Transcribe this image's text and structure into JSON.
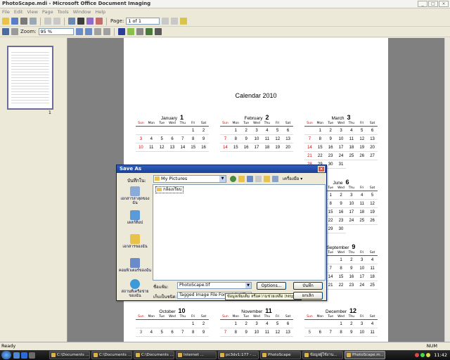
{
  "window": {
    "title": "PhotoScape.mdi - Microsoft Office Document Imaging",
    "controls": [
      "_",
      "□",
      "×"
    ]
  },
  "menu": [
    "File",
    "Edit",
    "View",
    "Page",
    "Tools",
    "Window",
    "Help"
  ],
  "toolbar1": {
    "page_label": "Page:",
    "page_value": "1 of 1"
  },
  "toolbar2": {
    "zoom_label": "Zoom:",
    "zoom_value": "95 %"
  },
  "thumbnail": {
    "page_number": "1"
  },
  "calendar": {
    "title": "Calendar  2010",
    "dow": [
      "Sun",
      "Mon",
      "Tue",
      "Wed",
      "Thu",
      "Fri",
      "Sat"
    ],
    "months": [
      {
        "name": "January",
        "num": "1",
        "days": [
          "",
          "",
          "",
          "",
          "",
          "1",
          "2",
          "3",
          "4",
          "5",
          "6",
          "7",
          "8",
          "9",
          "10",
          "11",
          "12",
          "13",
          "14",
          "15",
          "16"
        ]
      },
      {
        "name": "February",
        "num": "2",
        "days": [
          "",
          "1",
          "2",
          "3",
          "4",
          "5",
          "6",
          "7",
          "8",
          "9",
          "10",
          "11",
          "12",
          "13",
          "14",
          "15",
          "16",
          "17",
          "18",
          "19",
          "20"
        ]
      },
      {
        "name": "March",
        "num": "3",
        "days": [
          "",
          "1",
          "2",
          "3",
          "4",
          "5",
          "6",
          "7",
          "8",
          "9",
          "10",
          "11",
          "12",
          "13",
          "14",
          "15",
          "16",
          "17",
          "18",
          "19",
          "20",
          "21",
          "22",
          "23",
          "24",
          "25",
          "26",
          "27",
          "28",
          "29",
          "30",
          "31"
        ]
      },
      {
        "name": "June",
        "num": "6",
        "days": [
          "",
          "",
          "1",
          "2",
          "3",
          "4",
          "5",
          "6",
          "7",
          "8",
          "9",
          "10",
          "11",
          "12",
          "13",
          "14",
          "15",
          "16",
          "17",
          "18",
          "19",
          "20",
          "21",
          "22",
          "23",
          "24",
          "25",
          "26",
          "27",
          "28",
          "29",
          "30"
        ]
      },
      {
        "name": "September",
        "num": "9",
        "days": [
          "",
          "",
          "",
          "1",
          "2",
          "3",
          "4",
          "5",
          "6",
          "7",
          "8",
          "9",
          "10",
          "11",
          "12",
          "13",
          "14",
          "15",
          "16",
          "17",
          "18",
          "19",
          "20",
          "21",
          "22",
          "23",
          "24",
          "25"
        ]
      },
      {
        "name": "October",
        "num": "10",
        "days": [
          "",
          "",
          "",
          "",
          "",
          "1",
          "2",
          "3",
          "4",
          "5",
          "6",
          "7",
          "8",
          "9"
        ]
      },
      {
        "name": "November",
        "num": "11",
        "days": [
          "",
          "1",
          "2",
          "3",
          "4",
          "5",
          "6",
          "7",
          "8",
          "9",
          "10",
          "11",
          "12",
          "13"
        ]
      },
      {
        "name": "December",
        "num": "12",
        "days": [
          "",
          "",
          "",
          "1",
          "2",
          "3",
          "4",
          "5",
          "6",
          "7",
          "8",
          "9",
          "10",
          "11"
        ]
      }
    ]
  },
  "dialog": {
    "title": "Save As",
    "look_in_label": "บันทึกใน:",
    "look_in_value": "My Pictures",
    "tools_label": "เครื่องมือ ▾",
    "places": [
      {
        "label": "เอกสารล่าสุดของฉัน"
      },
      {
        "label": "เดสก์ท็อป"
      },
      {
        "label": "เอกสารของฉัน"
      },
      {
        "label": "คอมพิวเตอร์ของฉัน"
      },
      {
        "label": "สถานที่เครือข่ายของฉัน"
      }
    ],
    "file_item": "กล้องเรียบ",
    "filename_label": "ชื่อแฟ้ม:",
    "filename_value": "PhotoScape.tif",
    "filetype_label": "เก็บเป็นชนิด:",
    "filetype_value": "Tagged Image File Format (*.tif)",
    "tooltip": "ข้อมูลเพิ่มเติม หรือความช่วยเหลือ (http://)",
    "options_button": "Options...",
    "save_button": "บันทึก",
    "cancel_button": "ยกเลิก"
  },
  "status": {
    "text": "Ready",
    "num": "NUM"
  },
  "taskbar": {
    "tasks": [
      "C:\\Documents ...",
      "C:\\Documents ...",
      "C:\\Documents ...",
      "Internet ...",
      "pc3dv1:177 - ...",
      "PhotoScape",
      "ข้อมูลผู้ใช้งาน...",
      "PhotoScape.m..."
    ],
    "clock": "11:42"
  }
}
